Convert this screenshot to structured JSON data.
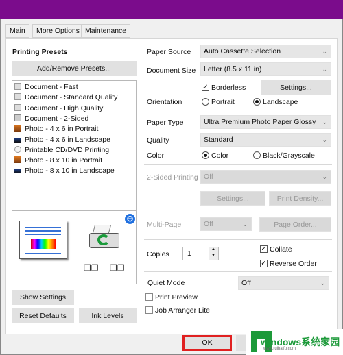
{
  "tabs": [
    "Main",
    "More Options",
    "Maintenance"
  ],
  "left": {
    "presets_title": "Printing Presets",
    "add_remove": "Add/Remove Presets...",
    "presets": [
      {
        "label": "Document - Fast",
        "icon": "document-icon"
      },
      {
        "label": "Document - Standard Quality",
        "icon": "document-icon"
      },
      {
        "label": "Document - High Quality",
        "icon": "document-icon"
      },
      {
        "label": "Document - 2-Sided",
        "icon": "document-2sided-icon"
      },
      {
        "label": "Photo - 4 x 6 in Portrait",
        "icon": "photo-portrait-icon"
      },
      {
        "label": "Photo - 4 x 6 in Landscape",
        "icon": "photo-landscape-icon"
      },
      {
        "label": "Printable CD/DVD Printing",
        "icon": "cd-icon"
      },
      {
        "label": "Photo - 8 x 10 in Portrait",
        "icon": "photo-portrait-icon"
      },
      {
        "label": "Photo - 8 x 10 in Landscape",
        "icon": "photo-landscape-icon"
      }
    ],
    "show_settings": "Show Settings",
    "reset_defaults": "Reset Defaults",
    "ink_levels": "Ink Levels"
  },
  "right": {
    "paper_source": {
      "label": "Paper Source",
      "value": "Auto Cassette Selection"
    },
    "document_size": {
      "label": "Document Size",
      "value": "Letter (8.5 x 11 in)"
    },
    "borderless": {
      "label": "Borderless",
      "checked": true
    },
    "settings_btn": "Settings...",
    "orientation": {
      "label": "Orientation",
      "options": [
        "Portrait",
        "Landscape"
      ],
      "selected": "Landscape"
    },
    "paper_type": {
      "label": "Paper Type",
      "value": "Ultra Premium Photo Paper Glossy"
    },
    "quality": {
      "label": "Quality",
      "value": "Standard"
    },
    "color": {
      "label": "Color",
      "options": [
        "Color",
        "Black/Grayscale"
      ],
      "selected": "Color"
    },
    "two_sided": {
      "label": "2-Sided Printing",
      "value": "Off"
    },
    "two_sided_settings": "Settings...",
    "print_density": "Print Density...",
    "multi_page": {
      "label": "Multi-Page",
      "value": "Off"
    },
    "page_order": "Page Order...",
    "copies": {
      "label": "Copies",
      "value": "1"
    },
    "collate": {
      "label": "Collate",
      "checked": true
    },
    "reverse_order": {
      "label": "Reverse Order",
      "checked": true
    },
    "quiet_mode": {
      "label": "Quiet Mode",
      "value": "Off"
    },
    "print_preview": {
      "label": "Print Preview",
      "checked": false
    },
    "job_arranger": {
      "label": "Job Arranger Lite",
      "checked": false
    }
  },
  "footer": {
    "ok": "OK"
  },
  "watermark": {
    "brand": "windows系统家园",
    "url": "www.ruihaifu.com"
  },
  "colors": {
    "titlebar": "#7b0c8c",
    "ok_highlight": "#e02020",
    "watermark_green": "#1d9a3a"
  }
}
